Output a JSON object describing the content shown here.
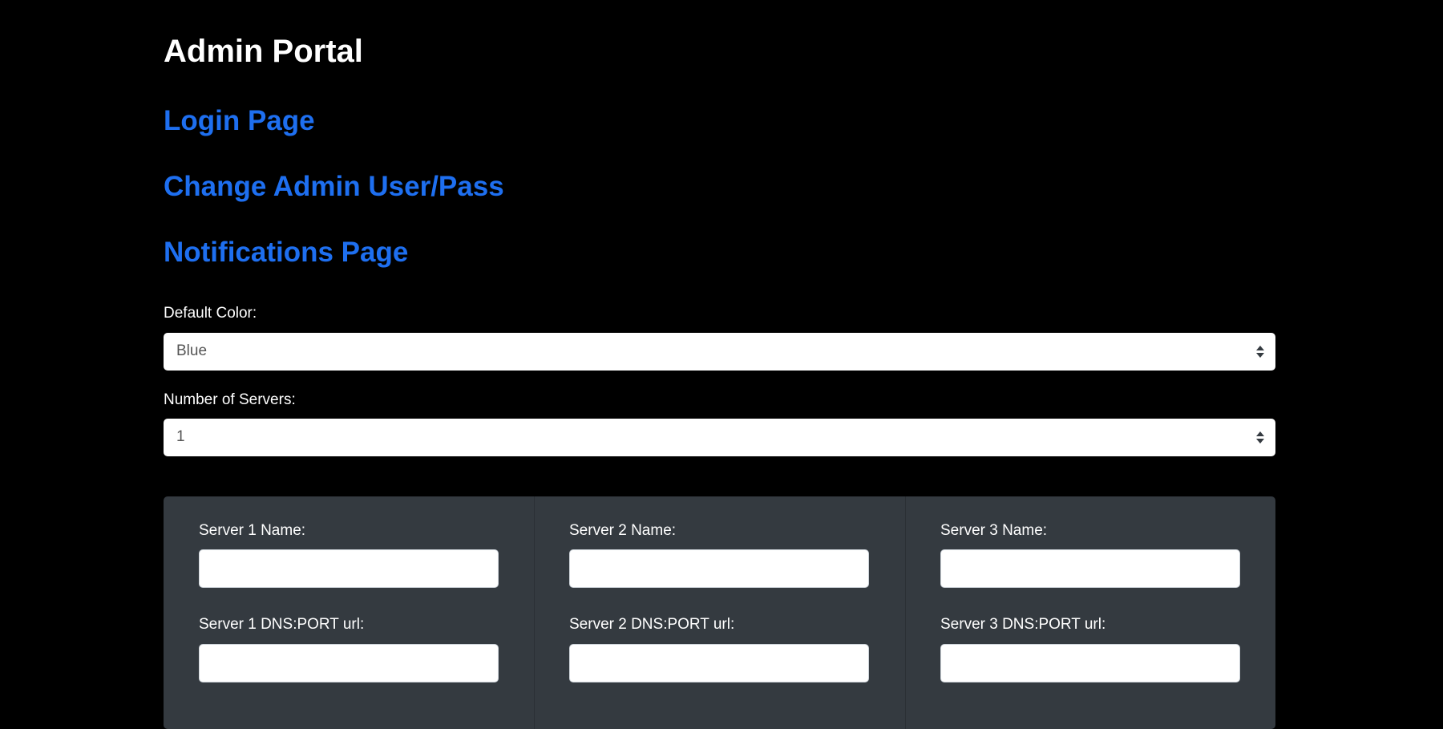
{
  "header": {
    "title": "Admin Portal"
  },
  "nav": {
    "login": "Login Page",
    "change_admin": "Change Admin User/Pass",
    "notifications": "Notifications Page"
  },
  "settings": {
    "default_color_label": "Default Color:",
    "default_color_value": "Blue",
    "num_servers_label": "Number of Servers:",
    "num_servers_value": "1"
  },
  "servers": [
    {
      "name_label": "Server 1 Name:",
      "name_value": "",
      "dns_label": "Server 1 DNS:PORT url:",
      "dns_value": ""
    },
    {
      "name_label": "Server 2 Name:",
      "name_value": "",
      "dns_label": "Server 2 DNS:PORT url:",
      "dns_value": ""
    },
    {
      "name_label": "Server 3 Name:",
      "name_value": "",
      "dns_label": "Server 3 DNS:PORT url:",
      "dns_value": ""
    }
  ],
  "colors": {
    "background": "#000000",
    "link": "#1e6ff0",
    "panel": "#343a40"
  },
  "icons": {
    "select_arrows": "select-arrows-icon"
  }
}
